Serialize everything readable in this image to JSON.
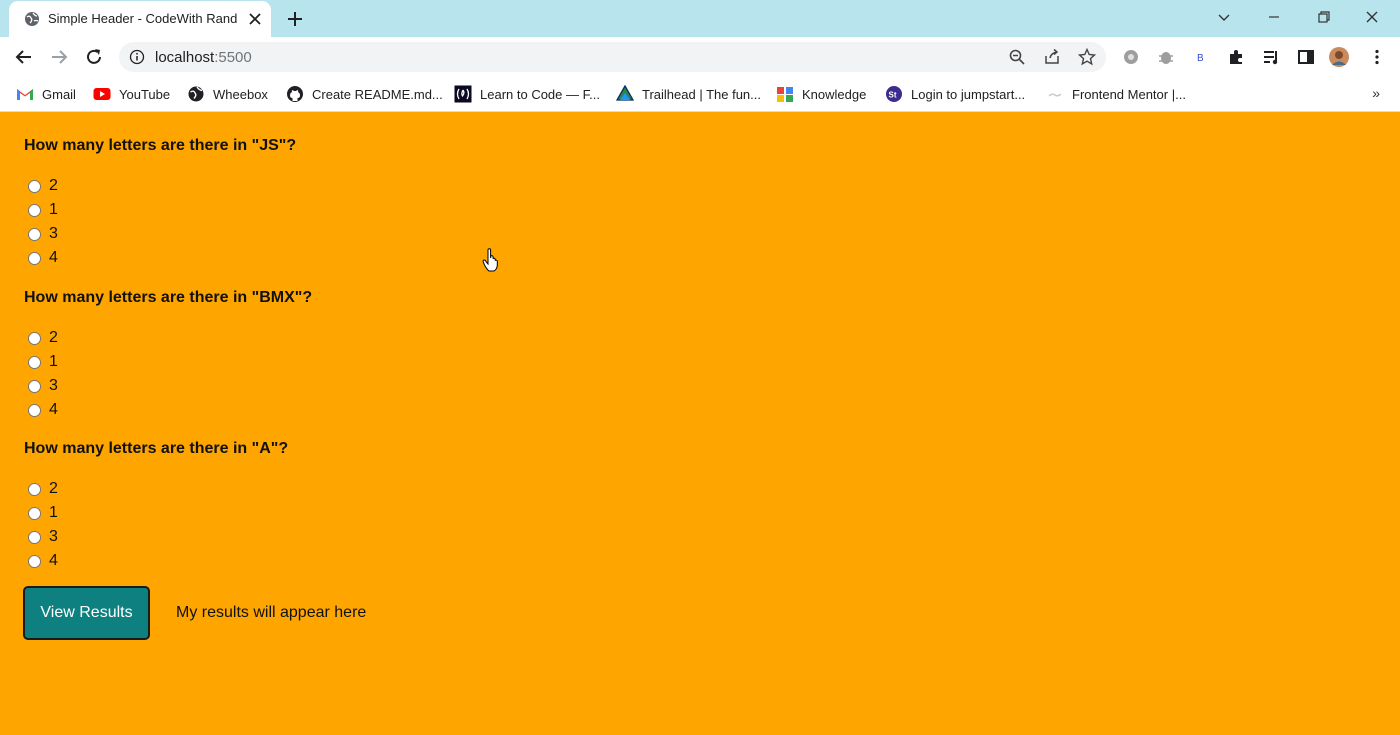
{
  "browser": {
    "tab_title": "Simple Header - CodeWith Rand",
    "url_host": "localhost",
    "url_port": ":5500",
    "bookmarks": [
      {
        "label": "Gmail",
        "icon": "gmail-icon"
      },
      {
        "label": "YouTube",
        "icon": "youtube-icon"
      },
      {
        "label": "Wheebox",
        "icon": "globe-icon"
      },
      {
        "label": "Create README.md...",
        "icon": "github-icon"
      },
      {
        "label": "Learn to Code — F...",
        "icon": "freecodecamp-icon"
      },
      {
        "label": "Trailhead | The fun...",
        "icon": "trailhead-icon"
      },
      {
        "label": "Knowledge",
        "icon": "knowledge-icon"
      },
      {
        "label": "Login to jumpstart...",
        "icon": "jumpstart-icon"
      },
      {
        "label": "Frontend Mentor |...",
        "icon": "frontend-mentor-icon"
      }
    ],
    "bookmarks_more": "»"
  },
  "quiz": {
    "questions": [
      {
        "text": "How many letters are there in \"JS\"?",
        "options": [
          "2",
          "1",
          "3",
          "4"
        ]
      },
      {
        "text": "How many letters are there in \"BMX\"?",
        "options": [
          "2",
          "1",
          "3",
          "4"
        ]
      },
      {
        "text": "How many letters are there in \"A\"?",
        "options": [
          "2",
          "1",
          "3",
          "4"
        ]
      }
    ],
    "view_button": "View Results",
    "result_text": "My results will appear here"
  },
  "colors": {
    "page_background": "#ffa500",
    "button_background": "#0e8080",
    "tabbar_background": "#b8e4ee"
  }
}
